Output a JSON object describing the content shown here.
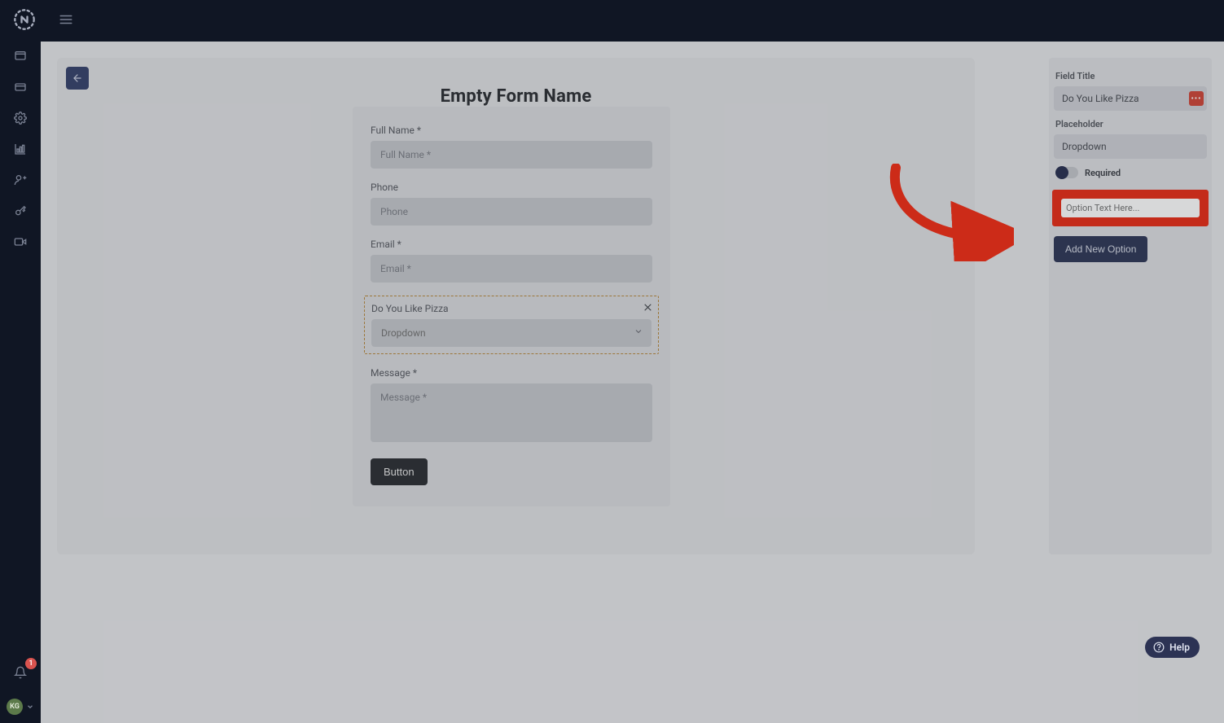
{
  "header": {
    "logo": "logo",
    "menuIcon": "menu"
  },
  "sidebar": {
    "icons": [
      "window",
      "card",
      "gear",
      "chart",
      "user-add",
      "key",
      "video"
    ],
    "notifBadge": "1",
    "avatarInitials": "KG"
  },
  "editor": {
    "backIcon": "arrow-left",
    "title": "Empty Form Name",
    "form": {
      "fields": [
        {
          "label": "Full Name *",
          "placeholder": "Full Name *",
          "type": "text"
        },
        {
          "label": "Phone",
          "placeholder": "Phone",
          "type": "text"
        },
        {
          "label": "Email *",
          "placeholder": "Email *",
          "type": "text"
        },
        {
          "label": "Do You Like Pizza",
          "placeholder": "Dropdown",
          "type": "select",
          "selected": true
        },
        {
          "label": "Message *",
          "placeholder": "Message *",
          "type": "textarea"
        }
      ],
      "submitLabel": "Button"
    }
  },
  "props": {
    "fieldTitleLabel": "Field Title",
    "fieldTitleValue": "Do You Like Pizza",
    "moreBtn": "more",
    "placeholderLabel": "Placeholder",
    "placeholderValue": "Dropdown",
    "requiredLabel": "Required",
    "requiredValue": false,
    "optionPlaceholder": "Option Text Here...",
    "optionValue": "",
    "addOptionLabel": "Add New Option"
  },
  "help": {
    "label": "Help"
  }
}
